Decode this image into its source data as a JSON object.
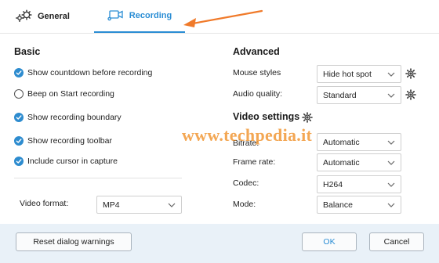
{
  "tabs": {
    "general": {
      "label": "General",
      "icon": "gears-icon"
    },
    "recording": {
      "label": "Recording",
      "icon": "video-camera-icon",
      "active": true
    }
  },
  "basic": {
    "title": "Basic",
    "options": [
      {
        "label": "Show countdown before recording",
        "checked": true
      },
      {
        "label": "Beep on Start recording",
        "checked": false
      },
      {
        "label": "Show recording boundary",
        "checked": true
      },
      {
        "label": "Show recording toolbar",
        "checked": true
      },
      {
        "label": "Include cursor in capture",
        "checked": true
      }
    ],
    "video_format": {
      "label": "Video format:",
      "value": "MP4"
    }
  },
  "advanced": {
    "title": "Advanced",
    "mouse_styles": {
      "label": "Mouse styles",
      "value": "Hide hot spot"
    },
    "audio_quality": {
      "label": "Audio quality:",
      "value": "Standard"
    }
  },
  "video_settings": {
    "title": "Video settings",
    "bitrate": {
      "label": "Bitrate:",
      "value": "Automatic"
    },
    "frame_rate": {
      "label": "Frame rate:",
      "value": "Automatic"
    },
    "codec": {
      "label": "Codec:",
      "value": "H264"
    },
    "mode": {
      "label": "Mode:",
      "value": "Balance"
    }
  },
  "watermark": "www.techpedia.it",
  "footer": {
    "reset_label": "Reset dialog warnings",
    "ok_label": "OK",
    "cancel_label": "Cancel"
  },
  "colors": {
    "accent": "#2a8dd4",
    "arrow": "#f07a2a",
    "footer_bg": "#e9f1f8",
    "watermark": "#f08a1c"
  }
}
